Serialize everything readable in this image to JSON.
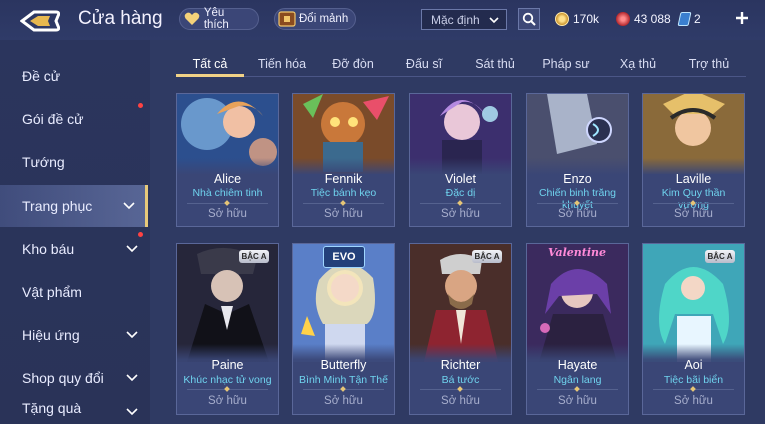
{
  "header": {
    "title": "Cửa hàng",
    "favorites_label": "Yêu thích",
    "fragments_label": "Đổi mảnh",
    "sort_value": "Mặc định",
    "currencies": [
      {
        "icon": "gold-coin-icon",
        "value": "170k",
        "color": "#f2c65a"
      },
      {
        "icon": "ruby-icon",
        "value": "43 088",
        "color": "#e0474c"
      },
      {
        "icon": "voucher-icon",
        "value": "2",
        "color": "#8fd5ff"
      }
    ]
  },
  "sidebar": {
    "items": [
      {
        "label": "Đề cử"
      },
      {
        "label": "Gói đề cử"
      },
      {
        "label": "Tướng"
      },
      {
        "label": "Trang phục"
      },
      {
        "label": "Kho báu"
      },
      {
        "label": "Vật phẩm"
      },
      {
        "label": "Hiệu ứng"
      },
      {
        "label": "Shop quy đổi"
      },
      {
        "label": "Tặng quà"
      }
    ]
  },
  "tabs": [
    "Tất cả",
    "Tiến hóa",
    "Đỡ đòn",
    "Đấu sĩ",
    "Sát thủ",
    "Pháp sư",
    "Xạ thủ",
    "Trợ thủ"
  ],
  "cards": [
    {
      "name": "Alice",
      "skin": "Nhà chiêm tinh",
      "status": "Sở hữu"
    },
    {
      "name": "Fennik",
      "skin": "Tiệc bánh kẹo",
      "status": "Sở hữu"
    },
    {
      "name": "Violet",
      "skin": "Đặc dị",
      "status": "Sở hữu"
    },
    {
      "name": "Enzo",
      "skin": "Chiến binh trăng khuyết",
      "status": "Sở hữu"
    },
    {
      "name": "Laville",
      "skin": "Kim Quy thần vương",
      "status": "Sở hữu"
    },
    {
      "name": "Paine",
      "skin": "Khúc nhạc tử vong",
      "status": "Sở hữu",
      "badge": "BẬC A"
    },
    {
      "name": "Butterfly",
      "skin": "Bình Minh Tận Thế",
      "status": "Sở hữu",
      "badge": "EVO"
    },
    {
      "name": "Richter",
      "skin": "Bá tước",
      "status": "Sở hữu",
      "badge": "BẬC A"
    },
    {
      "name": "Hayate",
      "skin": "Ngân lang",
      "status": "Sở hữu",
      "badge": "Valentine"
    },
    {
      "name": "Aoi",
      "skin": "Tiệc bãi biển",
      "status": "Sở hữu",
      "badge": "BẬC A"
    }
  ]
}
